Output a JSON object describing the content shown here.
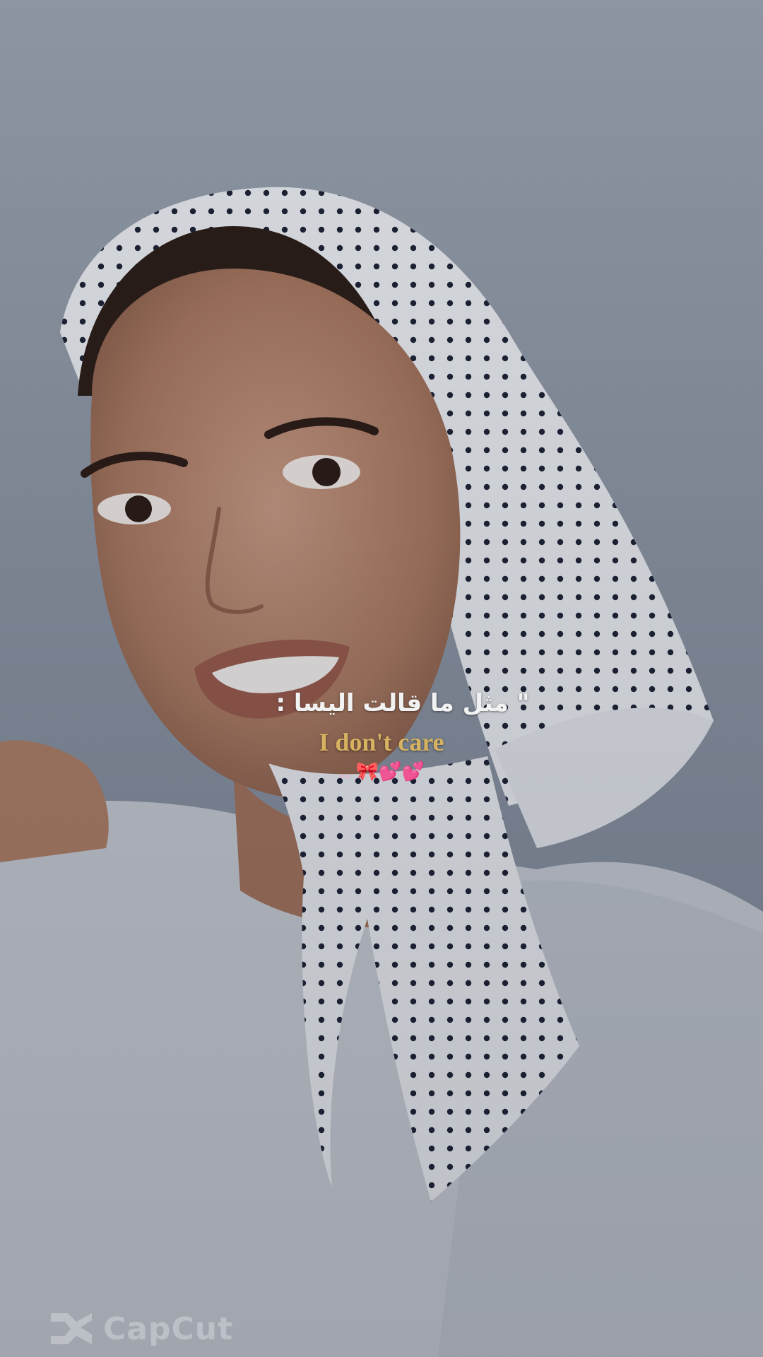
{
  "caption": {
    "arabic_line": "\" مثل ما قالت اليسا :",
    "english_line": "I don't care",
    "emoji_line": ".. 🎀💕💕"
  },
  "watermark": {
    "icon": "capcut-logo-icon",
    "text": "CapCut"
  },
  "colors": {
    "background": "#8d95a3",
    "caption_gold": "#d7b260",
    "caption_white": "#f2f2f2"
  }
}
